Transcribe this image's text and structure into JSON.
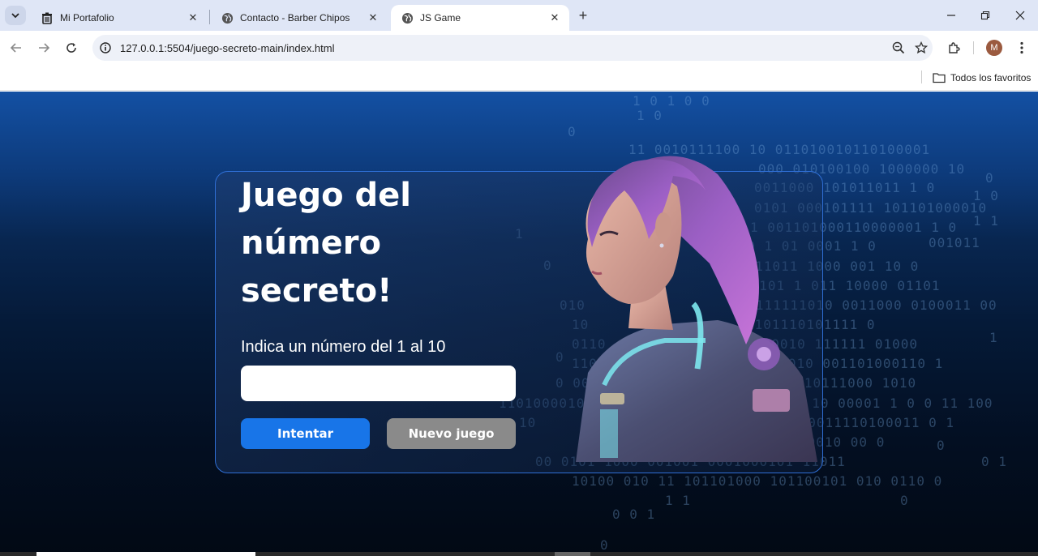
{
  "browser": {
    "tabs": [
      {
        "title": "Mi Portafolio",
        "icon": "trash-icon",
        "active": false
      },
      {
        "title": "Contacto - Barber Chipos",
        "icon": "globe-icon",
        "active": false
      },
      {
        "title": "JS Game",
        "icon": "globe-icon",
        "active": true
      }
    ],
    "address": "127.0.0.1:5504/juego-secreto-main/index.html",
    "profile_initial": "M",
    "bookmarks_all": "Todos los favoritos"
  },
  "game": {
    "title_line1": "Juego del",
    "title_line2": "número",
    "title_line3": "secreto!",
    "prompt": "Indica un número del 1 al 10",
    "input_value": "",
    "try_label": "Intentar",
    "new_game_label": "Nuevo juego"
  },
  "colors": {
    "accent": "#1875e8",
    "secondary_button": "#8a8a8a",
    "background_top": "#1350a3",
    "background_bottom": "#020914"
  }
}
